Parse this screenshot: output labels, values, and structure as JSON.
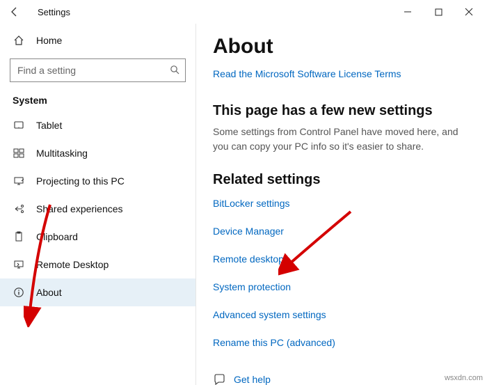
{
  "titlebar": {
    "title": "Settings"
  },
  "sidebar": {
    "home": "Home",
    "search_placeholder": "Find a setting",
    "section": "System",
    "items": [
      {
        "icon": "tablet",
        "label": "Tablet"
      },
      {
        "icon": "multitask",
        "label": "Multitasking"
      },
      {
        "icon": "project",
        "label": "Projecting to this PC"
      },
      {
        "icon": "shared",
        "label": "Shared experiences"
      },
      {
        "icon": "clipboard",
        "label": "Clipboard"
      },
      {
        "icon": "remote",
        "label": "Remote Desktop"
      },
      {
        "icon": "info",
        "label": "About"
      }
    ]
  },
  "content": {
    "heading": "About",
    "license_link": "Read the Microsoft Software License Terms",
    "subheading": "This page has a few new settings",
    "description": "Some settings from Control Panel have moved here, and you can copy your PC info so it's easier to share.",
    "related_heading": "Related settings",
    "related": [
      "BitLocker settings",
      "Device Manager",
      "Remote desktop",
      "System protection",
      "Advanced system settings",
      "Rename this PC (advanced)"
    ],
    "help": "Get help"
  },
  "watermark": "wsxdn.com"
}
